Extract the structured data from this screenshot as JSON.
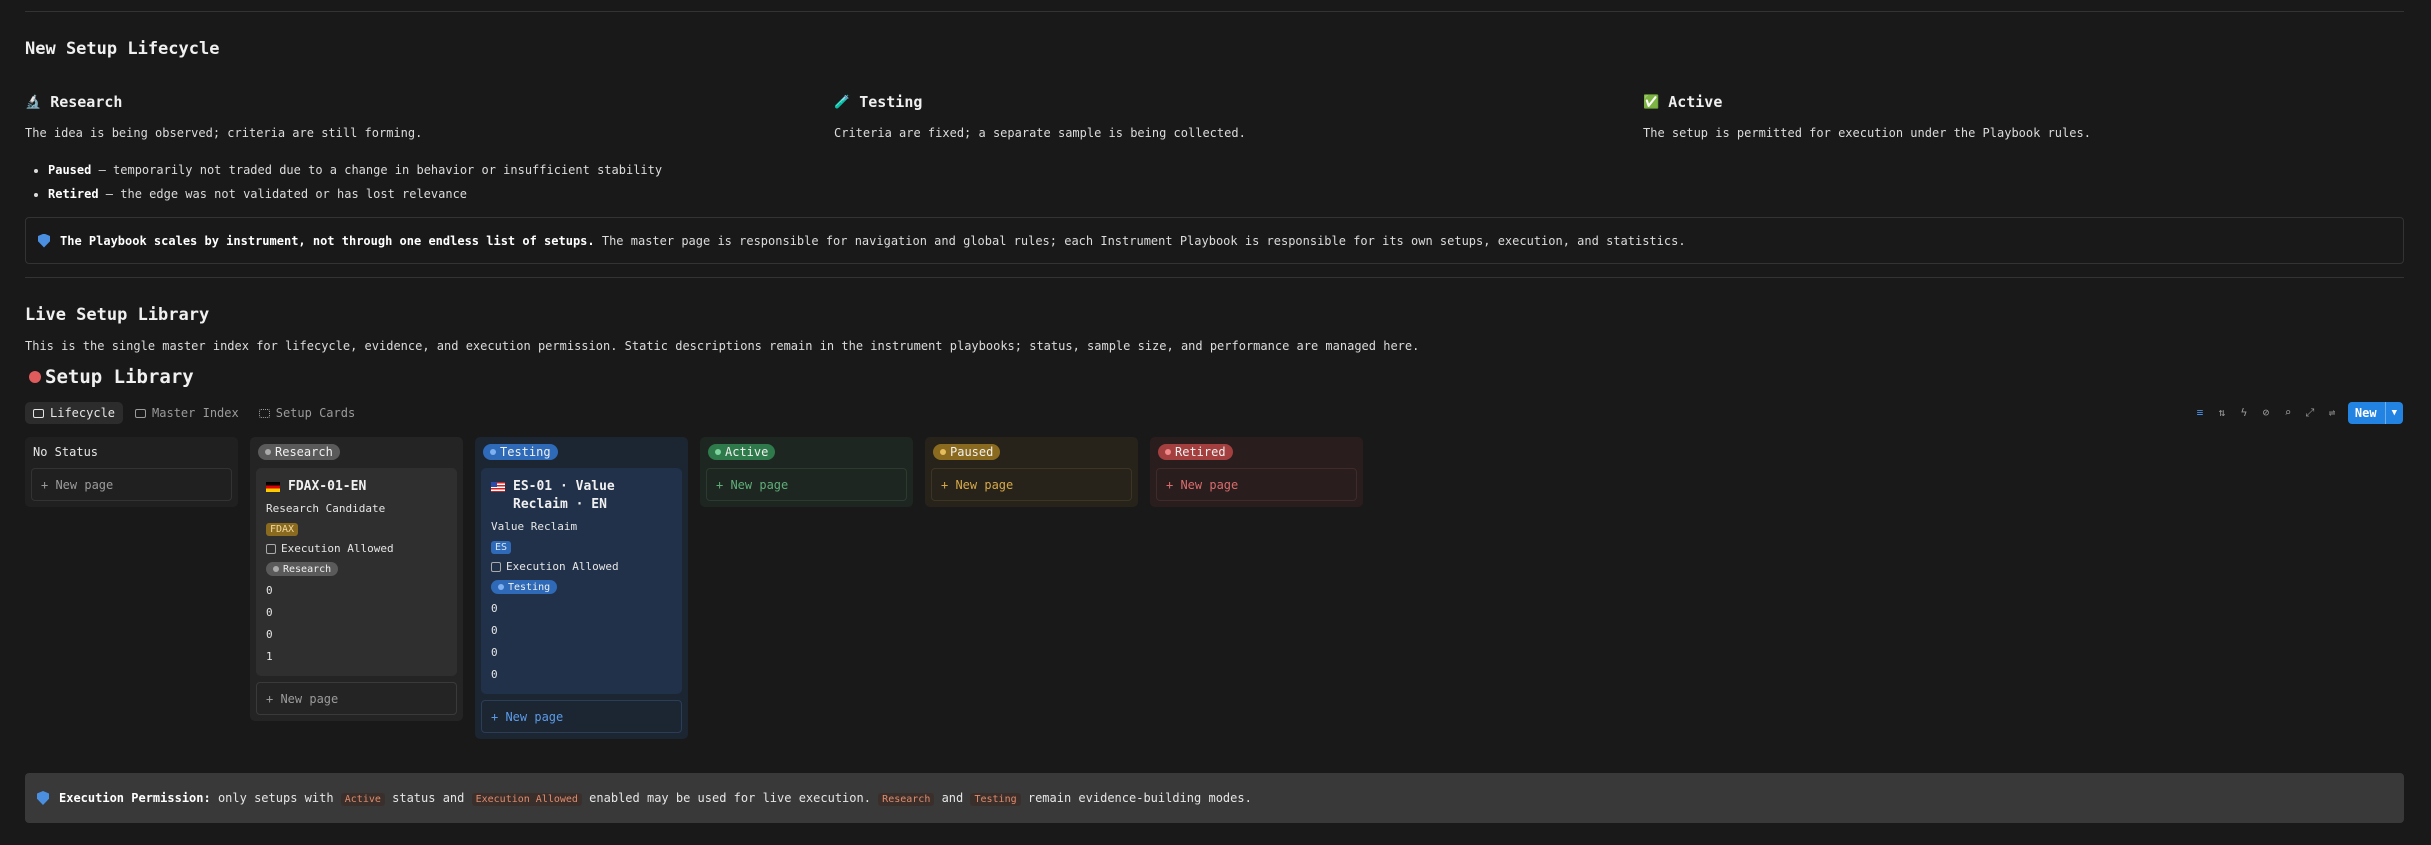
{
  "lifecycle": {
    "title": "New Setup Lifecycle",
    "columns": [
      {
        "emoji": "🔬",
        "heading": "Research",
        "text": "The idea is being observed; criteria are still forming."
      },
      {
        "emoji": "🧪",
        "heading": "Testing",
        "text": "Criteria are fixed; a separate sample is being collected."
      },
      {
        "emoji": "✅",
        "heading": "Active",
        "text": "The setup is permitted for execution under the Playbook rules."
      }
    ],
    "bullets": [
      {
        "term": "Paused",
        "text": " — temporarily not traded due to a change in behavior or insufficient stability"
      },
      {
        "term": "Retired",
        "text": " — the edge was not validated or has lost relevance"
      }
    ],
    "callout_bold": "The Playbook scales by instrument, not through one endless list of setups.",
    "callout_text": " The master page is responsible for navigation and global rules; each Instrument Playbook is responsible for its own setups, execution, and statistics."
  },
  "library": {
    "title": "Live Setup Library",
    "description": "This is the single master index for lifecycle, evidence, and execution permission. Static descriptions remain in the instrument playbooks; status, sample size, and performance are managed here.",
    "db_title": "Setup Library",
    "tabs": [
      "Lifecycle",
      "Master Index",
      "Setup Cards"
    ],
    "new_button": "New",
    "colors": {
      "research": "#5a5a5a",
      "testing": "#2e6ab8",
      "active": "#2e7a4a",
      "paused": "#8a6a1f",
      "retired": "#a33f3f"
    }
  },
  "board": {
    "new_page_label": "+ New page",
    "columns": [
      {
        "name": "No Status",
        "cards": []
      },
      {
        "name": "Research",
        "cards": [
          {
            "title": "FDAX-01-EN",
            "subtitle": "Research Candidate",
            "tag": "FDAX",
            "checkbox": "Execution Allowed",
            "status": "Research",
            "numbers": [
              "0",
              "0",
              "0",
              "1"
            ]
          }
        ]
      },
      {
        "name": "Testing",
        "cards": [
          {
            "title": "ES-01 · Value Reclaim · EN",
            "subtitle": "Value Reclaim",
            "tag": "ES",
            "checkbox": "Execution Allowed",
            "status": "Testing",
            "numbers": [
              "0",
              "0",
              "0",
              "0"
            ]
          }
        ]
      },
      {
        "name": "Active",
        "cards": []
      },
      {
        "name": "Paused",
        "cards": []
      },
      {
        "name": "Retired",
        "cards": []
      }
    ]
  },
  "permission": {
    "label": "Execution Permission:",
    "t1": " only setups with ",
    "c1": "Active",
    "t2": " status and ",
    "c2": "Execution Allowed",
    "t3": " enabled may be used for live execution. ",
    "c3": "Research",
    "t4": " and ",
    "c4": "Testing",
    "t5": " remain evidence-building modes."
  }
}
